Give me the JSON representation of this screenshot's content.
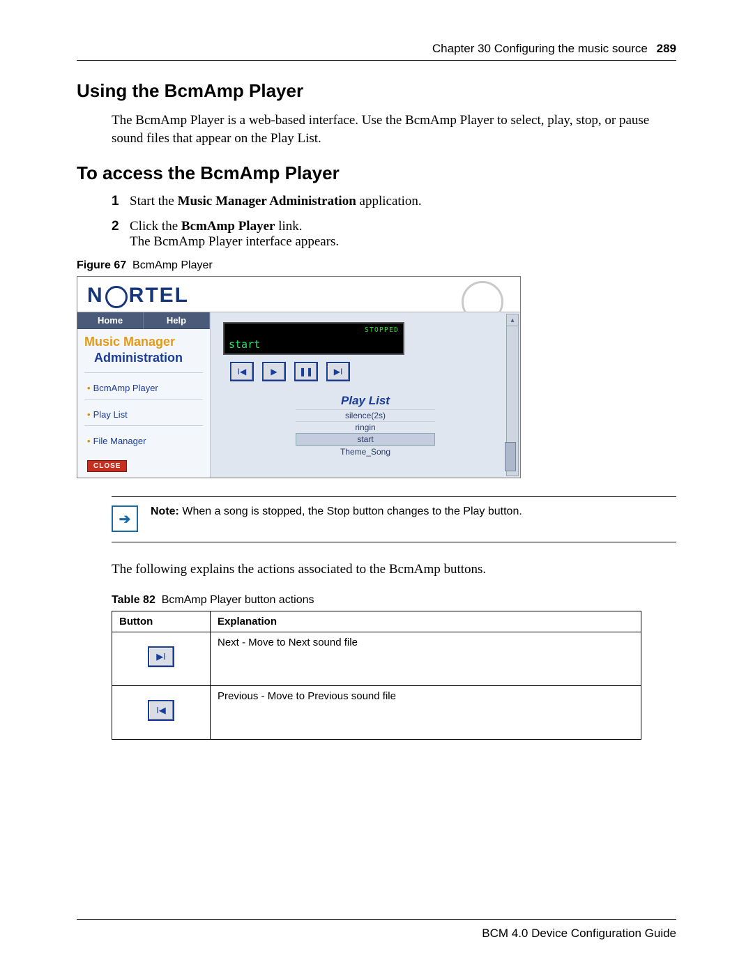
{
  "header": {
    "chapter": "Chapter 30  Configuring the music source",
    "page": "289"
  },
  "h2a": "Using the BcmAmp Player",
  "p1": "The BcmAmp Player is a web-based interface. Use the BcmAmp Player to select, play, stop, or pause sound files that appear on the Play List.",
  "h2b": "To access the BcmAmp Player",
  "steps": [
    {
      "num": "1",
      "pre": "Start the ",
      "strong": "Music Manager Administration",
      "post": " application."
    },
    {
      "num": "2",
      "pre": "Click the ",
      "strong": "BcmAmp Player",
      "post": " link."
    }
  ],
  "step2_extra": "The BcmAmp Player interface appears.",
  "fig_caption_label": "Figure 67",
  "fig_caption_text": "BcmAmp Player",
  "shot": {
    "logo": "NORTEL",
    "tabs": [
      "Home",
      "Help"
    ],
    "mm_title": "Music Manager",
    "mm_sub": "Administration",
    "links": [
      "BcmAmp Player",
      "Play List",
      "File Manager"
    ],
    "close": "CLOSE",
    "lcd_status": "STOPPED",
    "lcd_track": "start",
    "playlist_title": "Play List",
    "playlist": [
      "silence(2s)",
      "ringin",
      "start",
      "Theme_Song"
    ],
    "selected_index": 2
  },
  "note_label": "Note:",
  "note_text": "When a song is stopped, the Stop button changes to the Play button.",
  "p2": "The following explains the actions associated to the BcmAmp buttons.",
  "tbl_caption_label": "Table 82",
  "tbl_caption_text": "BcmAmp Player button actions",
  "tbl_h1": "Button",
  "tbl_h2": "Explanation",
  "tbl_rows": [
    {
      "icon": "next",
      "explain": "Next - Move to Next sound file"
    },
    {
      "icon": "prev",
      "explain": "Previous - Move to Previous sound file"
    }
  ],
  "footer": "BCM 4.0 Device Configuration Guide"
}
